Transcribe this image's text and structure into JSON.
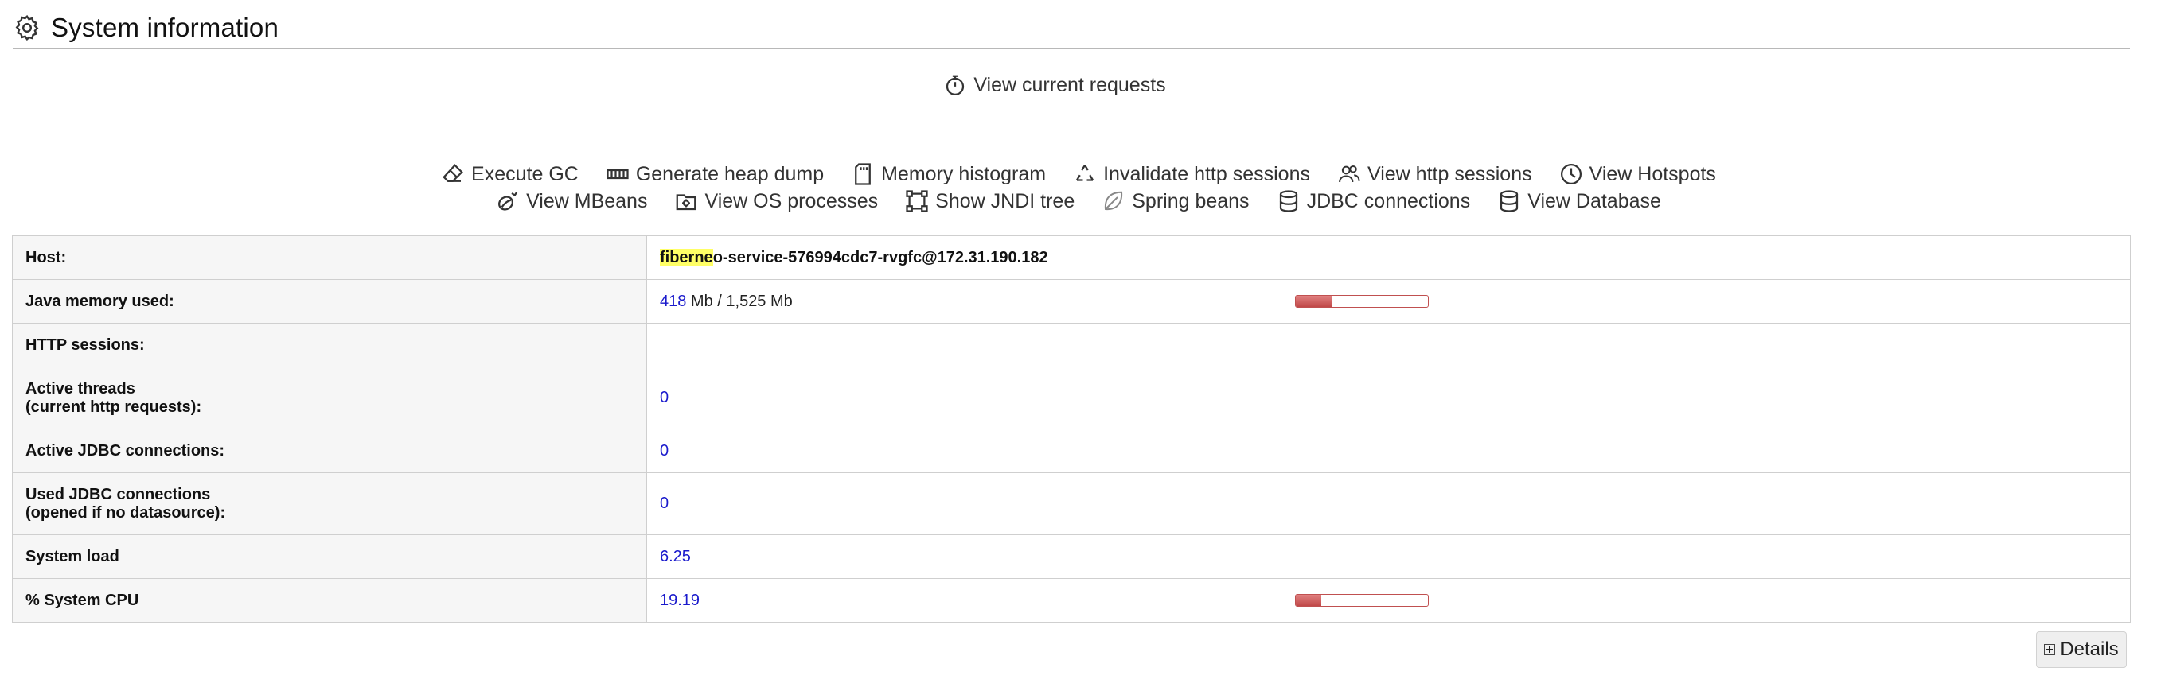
{
  "header": {
    "title": "System information"
  },
  "current_requests": {
    "label": "View current requests"
  },
  "actions_row1": [
    {
      "label": "Execute GC",
      "icon": "eraser-icon"
    },
    {
      "label": "Generate heap dump",
      "icon": "memory-icon"
    },
    {
      "label": "Memory histogram",
      "icon": "sd-card-icon"
    },
    {
      "label": "Invalidate http sessions",
      "icon": "recycle-icon"
    },
    {
      "label": "View http sessions",
      "icon": "users-icon"
    },
    {
      "label": "View Hotspots",
      "icon": "clock-icon"
    }
  ],
  "actions_row2": [
    {
      "label": "View MBeans",
      "icon": "beans-icon"
    },
    {
      "label": "View OS processes",
      "icon": "gear-box-icon"
    },
    {
      "label": "Show JNDI tree",
      "icon": "tree-nodes-icon"
    },
    {
      "label": "Spring beans",
      "icon": "leaf-icon"
    },
    {
      "label": "JDBC connections",
      "icon": "database-icon"
    },
    {
      "label": "View Database",
      "icon": "database-icon"
    }
  ],
  "table": {
    "host_label": "Host:",
    "host_highlight": "fiberne",
    "host_rest": "o-service-576994cdc7-rvgfc@172.31.190.182",
    "memory_label": "Java memory used:",
    "memory_used": "418",
    "memory_rest": " Mb / 1,525 Mb",
    "memory_fraction": 0.27,
    "sessions_label": "HTTP sessions:",
    "threads_label_1": "Active threads",
    "threads_label_2": "(current http requests):",
    "threads_value": "0",
    "active_jdbc_label": "Active JDBC connections:",
    "active_jdbc_value": "0",
    "used_jdbc_label_1": "Used JDBC connections",
    "used_jdbc_label_2": "(opened if no datasource):",
    "used_jdbc_value": "0",
    "system_load_label": "System load",
    "system_load_value": "6.25",
    "cpu_label": "% System CPU",
    "cpu_value": "19.19",
    "cpu_fraction": 0.1919
  },
  "details_button": {
    "label": "Details"
  },
  "colors": {
    "bar_fill": "#c04848",
    "value_text": "#1a1acc",
    "highlight": "#ffff66"
  }
}
